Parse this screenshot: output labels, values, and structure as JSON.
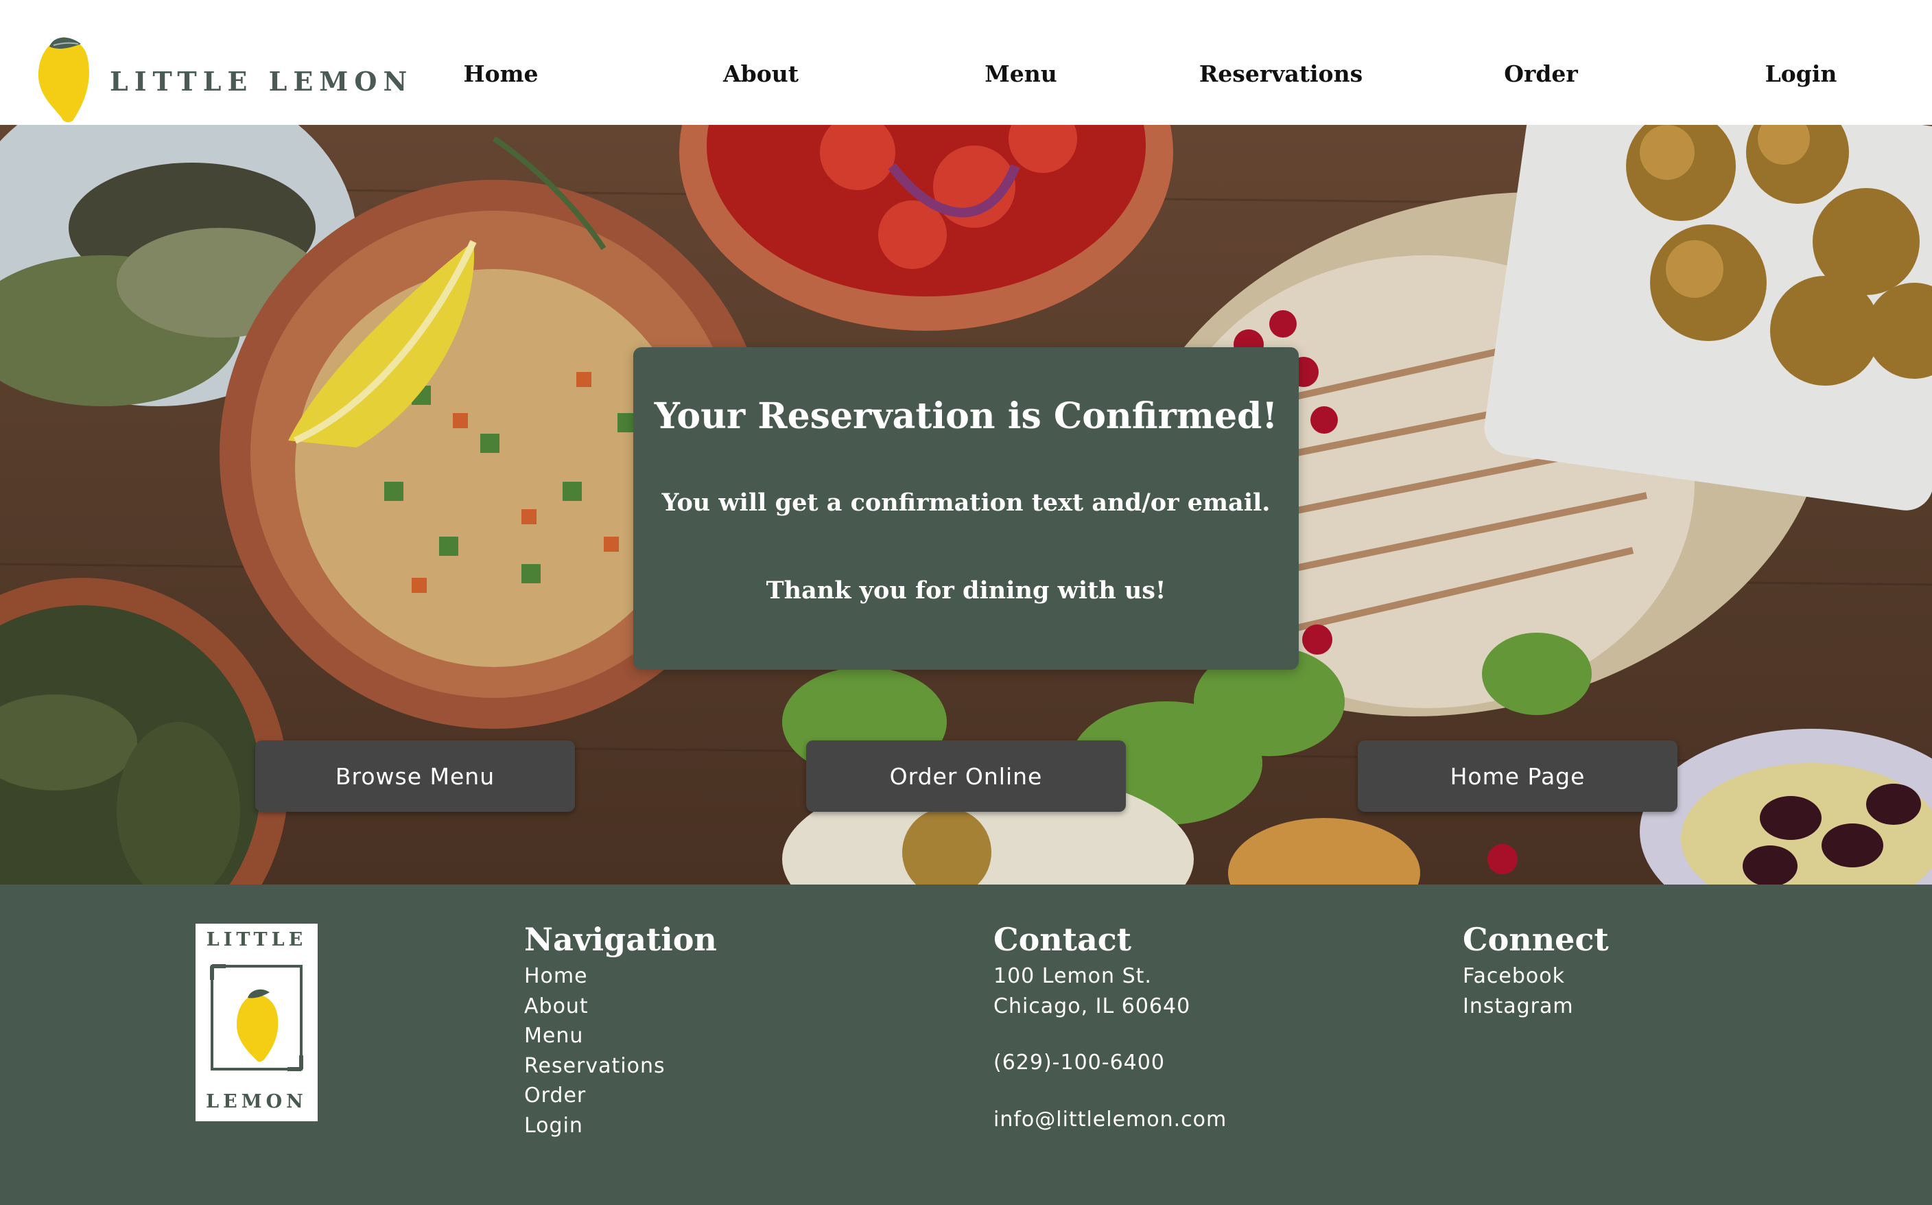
{
  "brand": {
    "name": "LITTLE LEMON",
    "footer_logo_top": "LITTLE",
    "footer_logo_bottom": "LEMON",
    "colors": {
      "primary_green": "#48594f",
      "lemon_yellow": "#f4ce14",
      "button_gray": "#454545"
    }
  },
  "nav": {
    "items": [
      {
        "label": "Home"
      },
      {
        "label": "About"
      },
      {
        "label": "Menu"
      },
      {
        "label": "Reservations"
      },
      {
        "label": "Order"
      },
      {
        "label": "Login"
      }
    ]
  },
  "confirmation": {
    "title": "Your Reservation is Confirmed!",
    "message": "You will get a confirmation text and/or email.",
    "thanks": "Thank you for dining with us!"
  },
  "actions": {
    "browse_menu": "Browse Menu",
    "order_online": "Order Online",
    "home_page": "Home Page"
  },
  "footer": {
    "navigation": {
      "heading": "Navigation",
      "links": [
        "Home",
        "About",
        "Menu",
        "Reservations",
        "Order",
        "Login"
      ]
    },
    "contact": {
      "heading": "Contact",
      "address_line1": "100 Lemon St.",
      "address_line2": "Chicago, IL 60640",
      "phone": "(629)-100-6400",
      "email": "info@littlelemon.com"
    },
    "connect": {
      "heading": "Connect",
      "links": [
        "Facebook",
        "Instagram"
      ]
    }
  },
  "icons": {
    "logo": "lemon-logo-icon",
    "hero_background": "mediterranean-food-photo"
  }
}
